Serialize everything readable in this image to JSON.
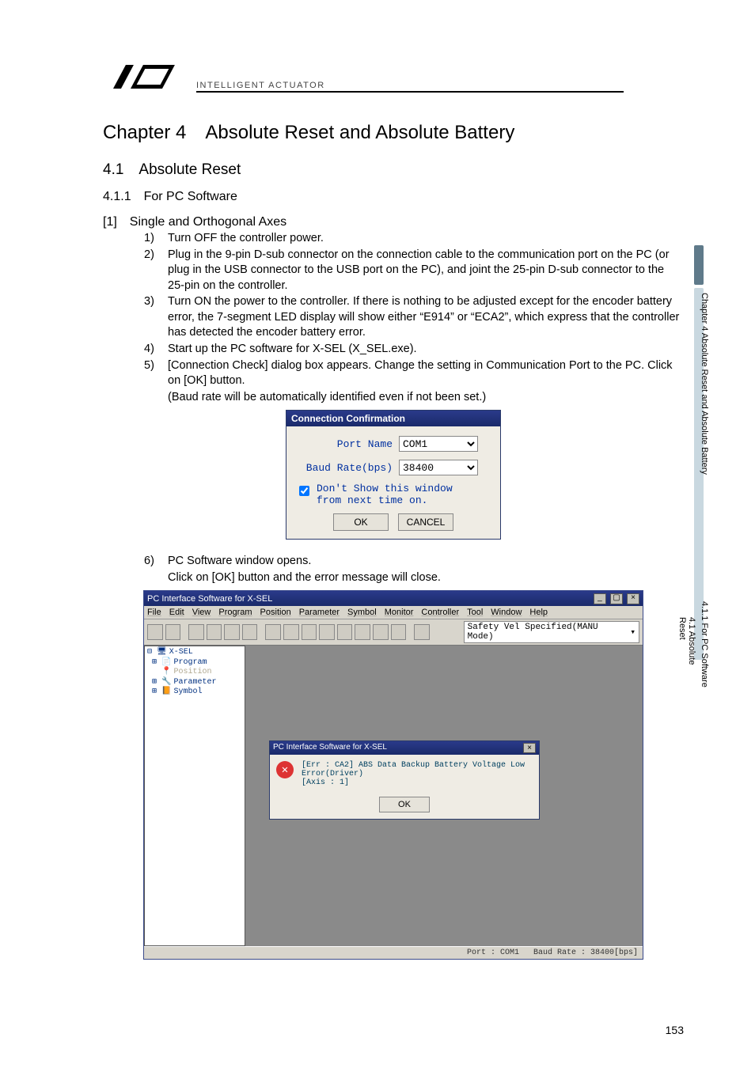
{
  "header": {
    "logo_text": "INTELLIGENT ACTUATOR"
  },
  "chapter": {
    "title": "Chapter 4 Absolute Reset and Absolute Battery",
    "section_title": "4.1 Absolute Reset",
    "subsection_title": "4.1.1 For PC Software",
    "item_title": "[1] Single and Orthogonal Axes"
  },
  "steps": [
    {
      "n": "1)",
      "t": "Turn OFF the controller power."
    },
    {
      "n": "2)",
      "t": "Plug in the 9-pin D-sub connector on the connection cable to the communication port on the PC (or plug in the USB connector to the USB port on the PC), and joint the 25-pin D-sub connector to the 25-pin on the controller."
    },
    {
      "n": "3)",
      "t": "Turn ON the power to the controller. If there is nothing to be adjusted except for the encoder battery error, the 7-segment LED display will show either “E914” or “ECA2”, which express that the controller has detected the encoder battery error."
    },
    {
      "n": "4)",
      "t": "Start up the PC software for X-SEL (X_SEL.exe)."
    },
    {
      "n": "5)",
      "t": "[Connection Check] dialog box appears. Change the setting in Communication Port to the PC. Click on [OK] button."
    }
  ],
  "step5_note": "(Baud rate will be automatically identified even if not been set.)",
  "step6": {
    "n": "6)",
    "t": "PC Software window opens.",
    "t2": "Click on [OK] button and the error message will close."
  },
  "dlg1": {
    "title": "Connection Confirmation",
    "port_label": "Port Name",
    "port_value": "COM1",
    "baud_label": "Baud Rate(bps)",
    "baud_value": "38400",
    "chk_line1": "Don't Show this window",
    "chk_line2": "from next time on.",
    "ok": "OK",
    "cancel": "CANCEL"
  },
  "appwin": {
    "title": "PC Interface Software for X-SEL",
    "menus": [
      "File",
      "Edit",
      "View",
      "Program",
      "Position",
      "Parameter",
      "Symbol",
      "Monitor",
      "Controller",
      "Tool",
      "Window",
      "Help"
    ],
    "mode_label": "Safety Vel Specified(MANU Mode)",
    "tree": [
      "X-SEL",
      "Program",
      "Position",
      "Parameter",
      "Symbol"
    ],
    "err": {
      "title": "PC Interface Software for X-SEL",
      "line1": "[Err : CA2] ABS Data Backup Battery Voltage Low Error(Driver)",
      "line2": "[Axis :   1]",
      "ok": "OK"
    },
    "status": {
      "port": "Port : COM1",
      "baud": "Baud Rate : 38400[bps]"
    }
  },
  "side": {
    "chapter": "Chapter 4 Absolute Reset and Absolute Battery",
    "s1": "4.1 Absolute Reset",
    "s2": "4.1.1 For PC Software"
  },
  "page_number": "153"
}
